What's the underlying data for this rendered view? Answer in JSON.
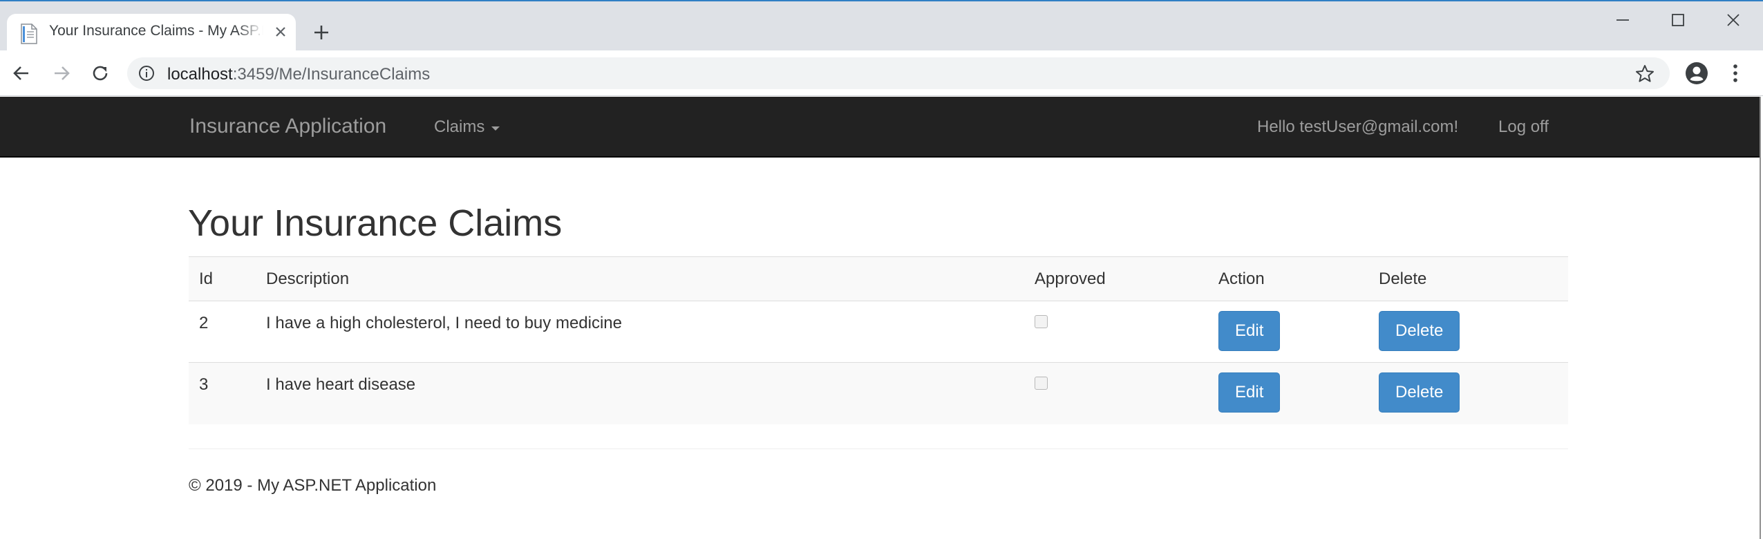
{
  "browser": {
    "tab_title": "Your Insurance Claims - My ASP.NET Application",
    "url_host": "localhost",
    "url_path": ":3459/Me/InsuranceClaims"
  },
  "navbar": {
    "brand": "Insurance Application",
    "claims_menu": "Claims",
    "greeting": "Hello testUser@gmail.com!",
    "logoff": "Log off"
  },
  "main": {
    "title": "Your Insurance Claims",
    "columns": [
      "Id",
      "Description",
      "Approved",
      "Action",
      "Delete"
    ],
    "rows": [
      {
        "id": "2",
        "description": "I have a high cholesterol, I need to buy medicine",
        "approved": false,
        "action_label": "Edit",
        "delete_label": "Delete"
      },
      {
        "id": "3",
        "description": "I have heart disease",
        "approved": false,
        "action_label": "Edit",
        "delete_label": "Delete"
      }
    ]
  },
  "footer": {
    "text": "© 2019 - My ASP.NET Application"
  },
  "colors": {
    "navbar_bg": "#222222",
    "navbar_text": "#9d9d9d",
    "button_primary": "#428bca"
  },
  "icons": [
    "document-icon",
    "close-icon",
    "plus-icon",
    "minimize-icon",
    "maximize-icon",
    "window-close-icon",
    "back-arrow-icon",
    "forward-arrow-icon",
    "reload-icon",
    "info-icon",
    "star-icon",
    "account-icon",
    "more-vert-icon",
    "caret-down-icon"
  ]
}
